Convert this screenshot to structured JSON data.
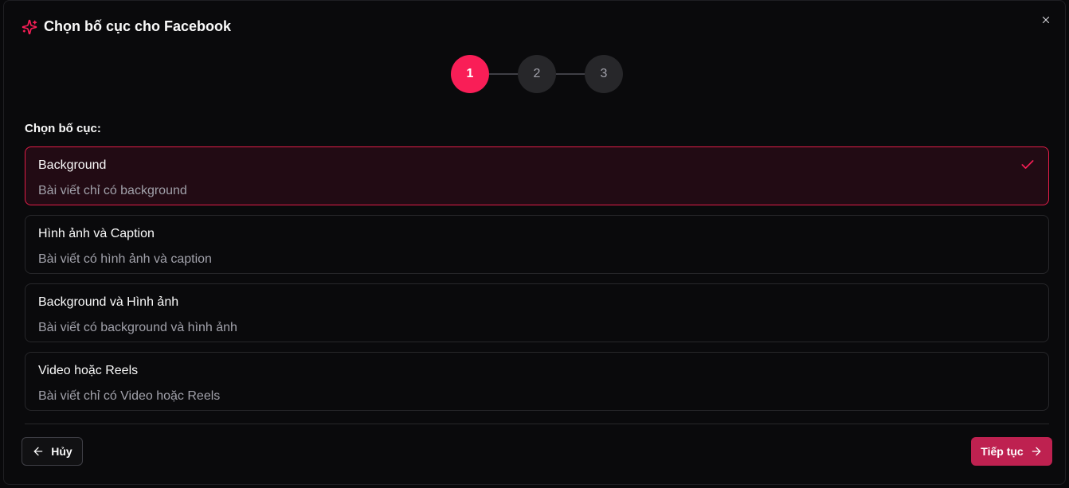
{
  "dialog": {
    "title": "Chọn bố cục cho Facebook",
    "accent_color": "#f91e57"
  },
  "stepper": {
    "steps": [
      "1",
      "2",
      "3"
    ],
    "current_step": 1
  },
  "layout_section": {
    "label": "Chọn bố cục:",
    "options": [
      {
        "title": "Background",
        "description": "Bài viết chỉ có background",
        "selected": true
      },
      {
        "title": "Hình ảnh và Caption",
        "description": "Bài viết có hình ảnh và caption",
        "selected": false
      },
      {
        "title": "Background và Hình ảnh",
        "description": "Bài viết có background và hình ảnh",
        "selected": false
      },
      {
        "title": "Video hoặc Reels",
        "description": "Bài viết chỉ có Video hoặc Reels",
        "selected": false
      }
    ]
  },
  "footer": {
    "cancel_label": "Hủy",
    "next_label": "Tiếp tục"
  },
  "icons": {
    "title_icon": "sparkles-icon",
    "close_icon": "close-icon",
    "check_icon": "check-icon",
    "cancel_icon": "arrow-left-icon",
    "next_icon": "arrow-right-icon"
  }
}
